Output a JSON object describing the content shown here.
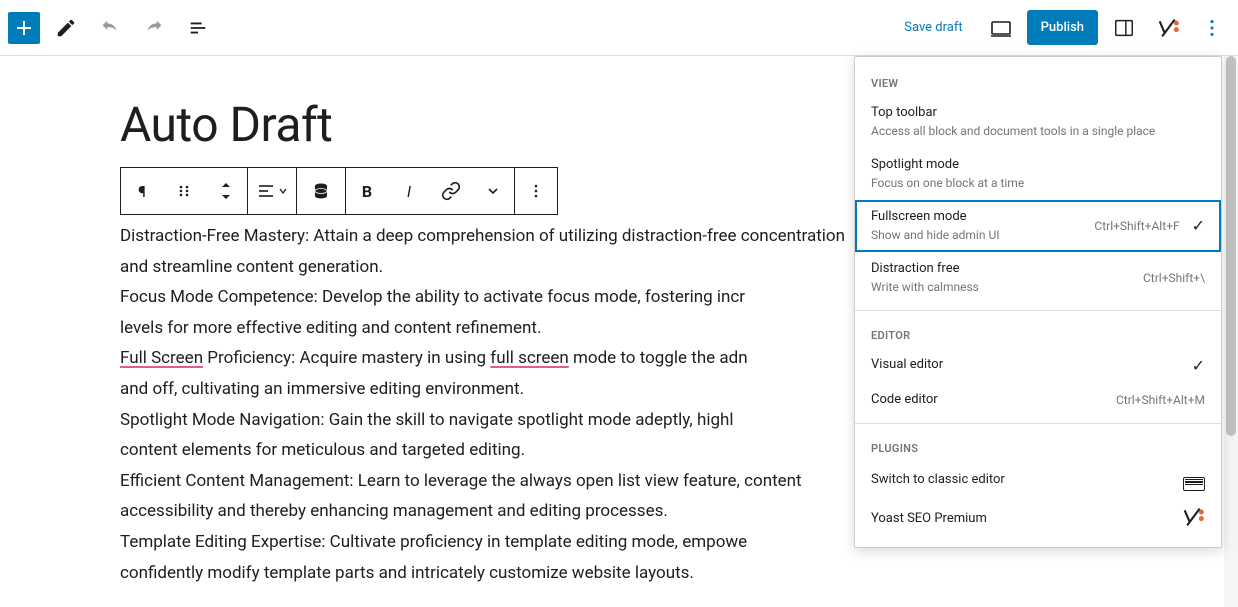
{
  "topbar": {
    "save_draft": "Save draft",
    "publish": "Publish"
  },
  "title": "Auto Draft",
  "content": {
    "p1_a": "Distraction-Free Mastery: Attain a deep comprehension of utilizing distraction-free concentration and streamline content generation.",
    "p2": "Focus Mode Competence: Develop the ability to activate focus mode, fostering incr",
    "p2b": "levels for more effective editing and content refinement.",
    "p3_a": "Full Screen",
    "p3_b": " Proficiency: Acquire mastery in using ",
    "p3_c": "full screen",
    "p3_d": " mode to toggle the adn",
    "p3_e": "and off, cultivating an immersive editing environment.",
    "p4": "Spotlight Mode Navigation: Gain the skill to navigate spotlight mode adeptly, highl",
    "p4b": "content elements for meticulous and targeted editing.",
    "p5": "Efficient Content Management: Learn to leverage the always open list view feature, content accessibility and thereby enhancing management and editing processes.",
    "p6": "Template Editing Expertise: Cultivate proficiency in template editing mode, empowe",
    "p6b": "confidently modify template parts and intricately customize website layouts."
  },
  "menu": {
    "section_view": "VIEW",
    "section_editor": "EDITOR",
    "section_plugins": "PLUGINS",
    "top_toolbar": {
      "title": "Top toolbar",
      "desc": "Access all block and document tools in a single place"
    },
    "spotlight": {
      "title": "Spotlight mode",
      "desc": "Focus on one block at a time"
    },
    "fullscreen": {
      "title": "Fullscreen mode",
      "desc": "Show and hide admin UI",
      "shortcut": "Ctrl+Shift+Alt+F"
    },
    "distraction": {
      "title": "Distraction free",
      "desc": "Write with calmness",
      "shortcut": "Ctrl+Shift+\\"
    },
    "visual_editor": {
      "title": "Visual editor"
    },
    "code_editor": {
      "title": "Code editor",
      "shortcut": "Ctrl+Shift+Alt+M"
    },
    "classic": {
      "title": "Switch to classic editor"
    },
    "yoast": {
      "title": "Yoast SEO Premium"
    }
  }
}
